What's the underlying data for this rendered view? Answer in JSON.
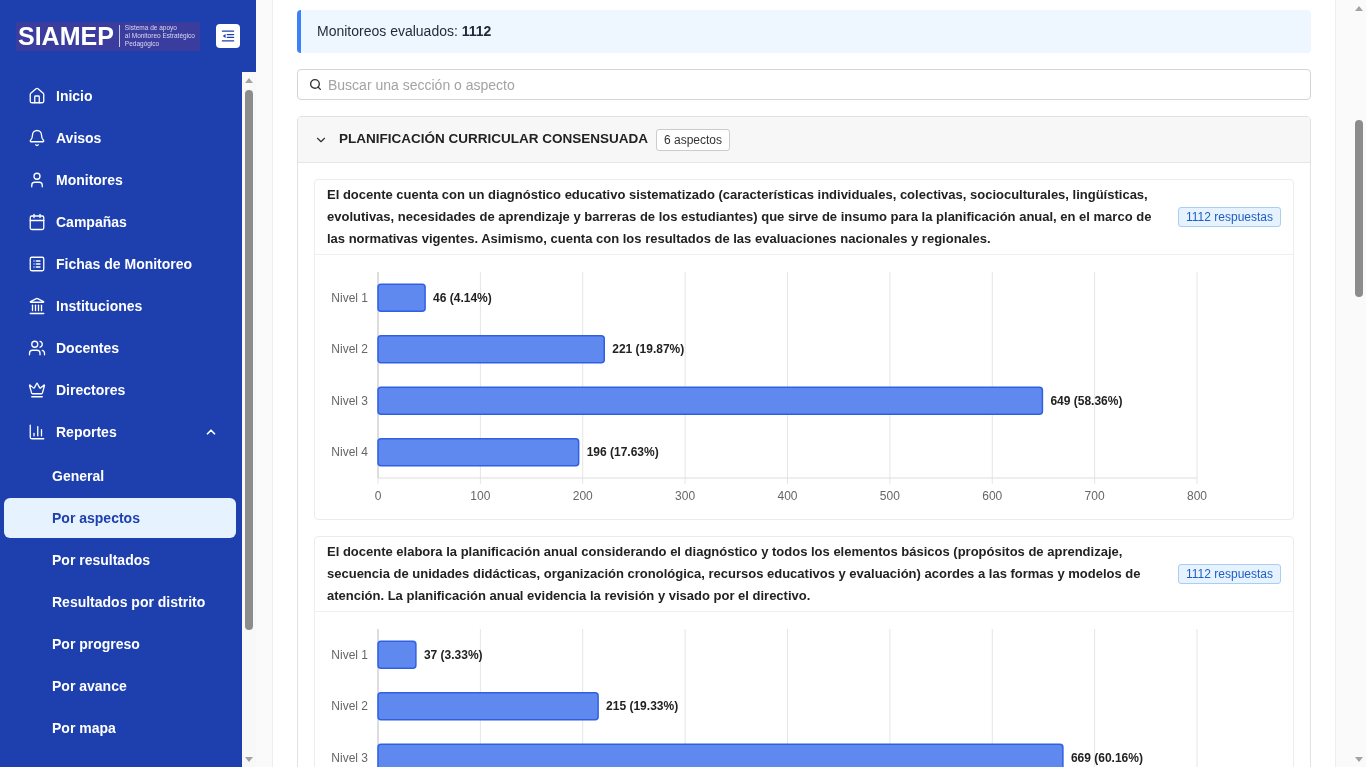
{
  "sidebar": {
    "logo": {
      "title": "SIAMEP",
      "subtitle_lines": [
        "Sistema de apoyo",
        "al Monitoreo Estratégico",
        "Pedagógico"
      ]
    },
    "items": [
      {
        "label": "Inicio",
        "selected": false
      },
      {
        "label": "Avisos",
        "selected": false
      },
      {
        "label": "Monitores",
        "selected": false
      },
      {
        "label": "Campañas",
        "selected": false
      },
      {
        "label": "Fichas de Monitoreo",
        "selected": false
      },
      {
        "label": "Instituciones",
        "selected": false
      },
      {
        "label": "Docentes",
        "selected": false
      },
      {
        "label": "Directores",
        "selected": false
      },
      {
        "label": "Reportes",
        "selected": false,
        "expanded": true,
        "children": [
          {
            "label": "General",
            "selected": false
          },
          {
            "label": "Por aspectos",
            "selected": true
          },
          {
            "label": "Por resultados",
            "selected": false
          },
          {
            "label": "Resultados por distrito",
            "selected": false
          },
          {
            "label": "Por progreso",
            "selected": false
          },
          {
            "label": "Por avance",
            "selected": false
          },
          {
            "label": "Por mapa",
            "selected": false
          }
        ]
      }
    ]
  },
  "summary": {
    "text": "Monitoreos evaluados: **1112**"
  },
  "search": {
    "placeholder": "Buscar una sección o aspecto"
  },
  "sections": [
    {
      "title": "PLANIFICACIÓN CURRICULAR CONSENSUADA",
      "badge": "6 aspectos",
      "expanded": true,
      "aspects": [
        {
          "text": "El docente cuenta con un diagnóstico educativo sistematizado (características individuales, colectivas, socioculturales, lingüísticas, evolutivas, necesidades de aprendizaje y barreras de los estudiantes) que sirve de insumo para la planificación anual, en el marco de las normativas vigentes. Asimismo, cuenta con los resultados de las evaluaciones nacionales y regionales.",
          "responses": "1112 respuestas",
          "chart_data": {
            "type": "bar",
            "orientation": "horizontal",
            "categories": [
              "Nivel 1",
              "Nivel 2",
              "Nivel 3",
              "Nivel 4"
            ],
            "values": [
              46,
              221,
              649,
              196
            ],
            "value_labels": [
              "46 (4.14%)",
              "221 (19.87%)",
              "649 (58.36%)",
              "196 (17.63%)"
            ],
            "xlim": [
              0,
              800
            ],
            "xticks": [
              0,
              100,
              200,
              300,
              400,
              500,
              600,
              700,
              800
            ],
            "grid": true
          }
        },
        {
          "text": "El docente elabora la planificación anual considerando el diagnóstico y todos los elementos básicos (propósitos de aprendizaje, secuencia de unidades didácticas, organización cronológica, recursos educativos y evaluación) acordes a las formas y modelos de atención. La planificación anual evidencia la revisión y visado por el directivo.",
          "responses": "1112 respuestas",
          "chart_data": {
            "type": "bar",
            "orientation": "horizontal",
            "categories": [
              "Nivel 1",
              "Nivel 2",
              "Nivel 3"
            ],
            "values": [
              37,
              215,
              669
            ],
            "value_labels": [
              "37 (3.33%)",
              "215 (19.33%)",
              "669 (60.16%)"
            ],
            "xlim": [
              0,
              800
            ],
            "grid": true
          }
        }
      ]
    }
  ]
}
